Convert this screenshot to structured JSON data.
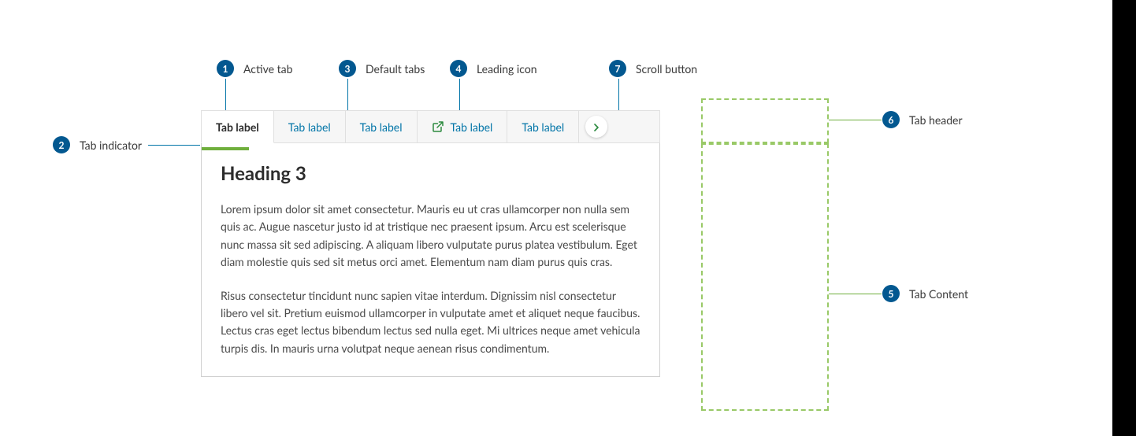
{
  "annotations": {
    "a1": {
      "num": "1",
      "label": "Active tab"
    },
    "a2": {
      "num": "2",
      "label": "Tab indicator"
    },
    "a3": {
      "num": "3",
      "label": "Default tabs"
    },
    "a4": {
      "num": "4",
      "label": "Leading icon"
    },
    "a5": {
      "num": "5",
      "label": "Tab Content"
    },
    "a6": {
      "num": "6",
      "label": "Tab header"
    },
    "a7": {
      "num": "7",
      "label": "Scroll button"
    }
  },
  "tabs": {
    "items": [
      {
        "label": "Tab label"
      },
      {
        "label": "Tab label"
      },
      {
        "label": "Tab label"
      },
      {
        "label": "Tab label"
      },
      {
        "label": "Tab label"
      }
    ]
  },
  "content": {
    "heading": "Heading 3",
    "p1": "Lorem ipsum dolor sit amet consectetur. Mauris eu ut cras ullamcorper non nulla sem quis ac. Augue nascetur justo id at tristique nec praesent ipsum. Arcu est scelerisque nunc massa sit sed adipiscing. A aliquam libero vulputate purus platea vestibulum. Eget diam molestie quis sed sit metus orci amet. Elementum nam diam purus quis cras.",
    "p2": "Risus consectetur tincidunt nunc sapien vitae interdum. Dignissim nisl consectetur libero vel sit. Pretium euismod ullamcorper in vulputate amet et aliquet neque faucibus. Lectus cras eget lectus bibendum lectus sed nulla eget. Mi ultrices neque amet vehicula turpis dis. In mauris urna volutpat neque aenean risus condimentum."
  }
}
